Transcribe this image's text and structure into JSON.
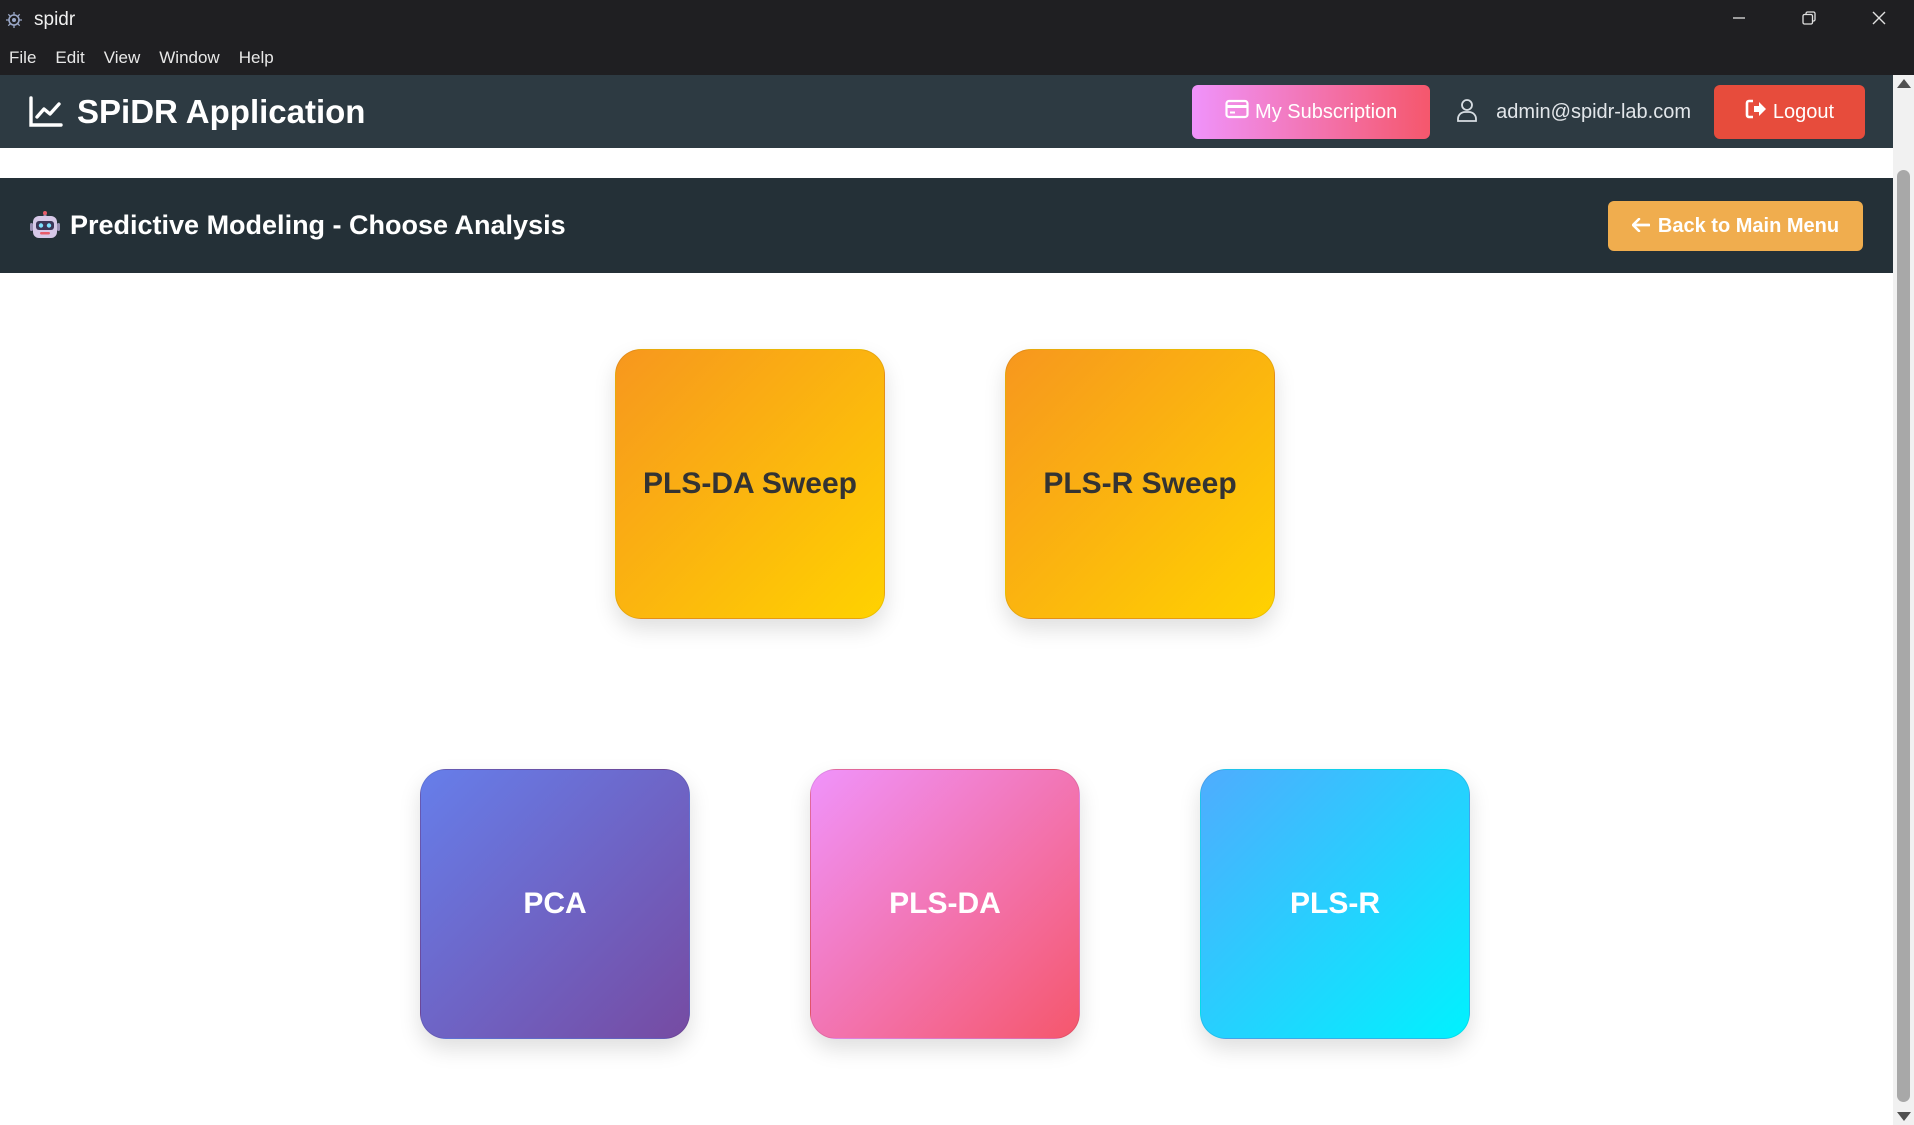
{
  "window": {
    "title": "spidr",
    "icon": "spidr-app-icon",
    "controls": [
      "minimize-icon",
      "restore-icon",
      "close-icon"
    ]
  },
  "menu": [
    "File",
    "Edit",
    "View",
    "Window",
    "Help"
  ],
  "header": {
    "brand_icon": "line-chart-icon",
    "brand_title": "SPiDR Application",
    "subscription_label": "My Subscription",
    "subscription_icon": "credit-card-icon",
    "user_icon": "user-icon",
    "user_email": "admin@spidr-lab.com",
    "logout_label": "Logout",
    "logout_icon": "sign-out-icon"
  },
  "section": {
    "icon": "robot-emoji-icon",
    "title": "Predictive Modeling - Choose Analysis",
    "back_label": "Back to Main Menu",
    "back_icon": "arrow-left-icon"
  },
  "cards": {
    "row1": [
      "PLS-DA Sweep",
      "PLS-R Sweep"
    ],
    "row2": [
      "PCA",
      "PLS-DA",
      "PLS-R"
    ]
  },
  "colors": {
    "header_bg": "#2d3a42",
    "section_bg": "#243037",
    "subscription_gradient": [
      "#f093fb",
      "#f5576c"
    ],
    "logout": "#e74c3c",
    "back_button": "#f0ad4e",
    "sweep_gradient": [
      "#f7971e",
      "#ffd200"
    ],
    "pca_gradient": [
      "#667eea",
      "#764ba2"
    ],
    "plsda_gradient": [
      "#f093fb",
      "#f5576c"
    ],
    "plsr_gradient": [
      "#4facfe",
      "#00f2fe"
    ]
  }
}
